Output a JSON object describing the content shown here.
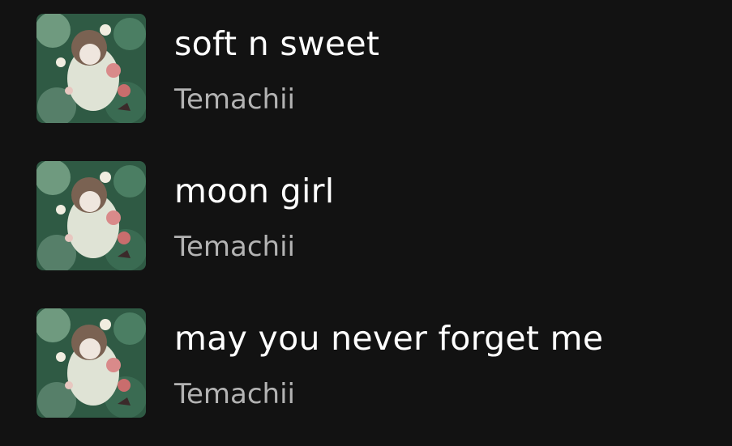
{
  "tracks": [
    {
      "title": "soft n sweet",
      "artist": "Temachii",
      "cover_icon": "album-cover-art"
    },
    {
      "title": "moon girl",
      "artist": "Temachii",
      "cover_icon": "album-cover-art"
    },
    {
      "title": "may you never forget me",
      "artist": "Temachii",
      "cover_icon": "album-cover-art"
    }
  ],
  "colors": {
    "background": "#121212",
    "title": "#ffffff",
    "artist": "#b3b3b3"
  }
}
